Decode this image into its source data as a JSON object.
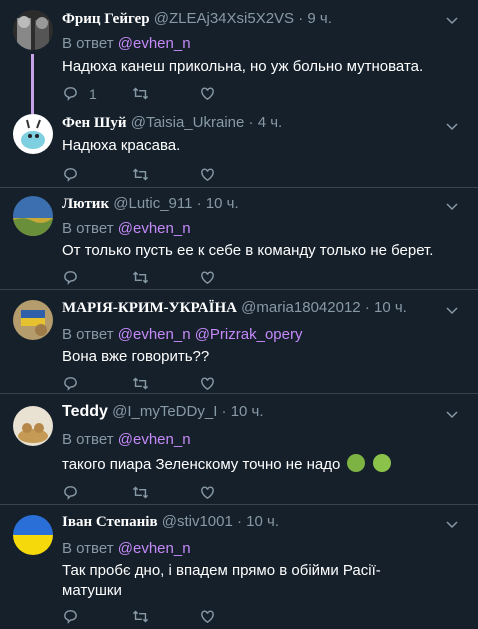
{
  "reply_prefix": "В ответ",
  "tweets": [
    {
      "name": "Фриц Гейгер",
      "handle": "@ZLEAj34Xsi5X2VS",
      "time": "9 ч.",
      "mentions": "@evhen_n",
      "text": "Надюха канеш прикольна, но уж больно мутновата.",
      "reply_count": "1"
    },
    {
      "name": "Фен Шуй",
      "handle": "@Taisia_Ukraine",
      "time": "4 ч.",
      "text": "Надюха красава."
    },
    {
      "name": "Лютик",
      "handle": "@Lutic_911",
      "time": "10 ч.",
      "mentions": "@evhen_n",
      "text": "От только пусть ее к себе в команду только не берет."
    },
    {
      "name": "МАРІЯ-КРИМ-УКРАЇНА",
      "handle": "@maria18042012",
      "time": "10 ч.",
      "mentions": "@evhen_n",
      "mention2": "@Prizrak_opery",
      "text": "Вона вже говорить??"
    },
    {
      "name": "Teddy",
      "handle": "@I_myTeDDy_I",
      "time": "10 ч.",
      "mentions": "@evhen_n",
      "text": "такого пиара Зеленскому точно не надо"
    },
    {
      "name": "Іван Степанів",
      "handle": "@stiv1001",
      "time": "10 ч.",
      "mentions": "@evhen_n",
      "text": "Так пробє дно, і впадем прямо в обійми Расії-матушки"
    }
  ],
  "separator": "·",
  "icons": {
    "reply": "reply-icon",
    "retweet": "retweet-icon",
    "like": "heart-icon",
    "menu": "chevron-down-icon",
    "emoji1": "nauseated-face-icon",
    "emoji2": "vomiting-face-icon"
  },
  "colors": {
    "background": "#15202b",
    "link": "#c58af9",
    "muted": "#8899a6",
    "thread": "#c6a2e8"
  }
}
